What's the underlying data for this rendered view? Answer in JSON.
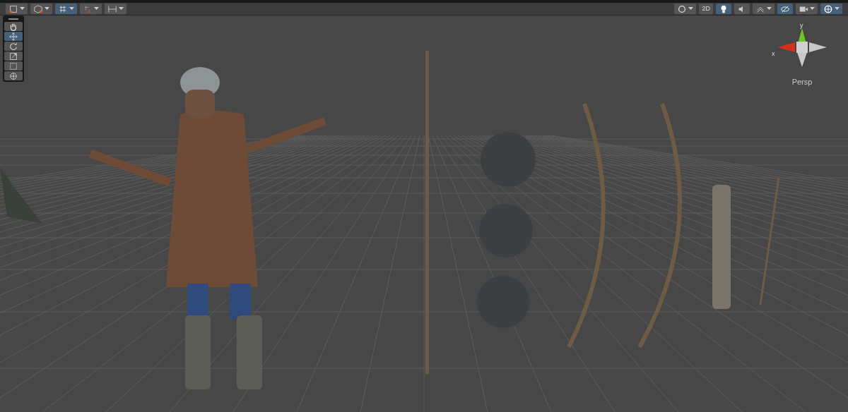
{
  "toolbar_left": [
    {
      "kind": "rect-tool",
      "selected": false,
      "dropdown": true
    },
    {
      "kind": "cube",
      "selected": false,
      "dropdown": true
    },
    {
      "kind": "grid-snap",
      "selected": true,
      "dropdown": true
    },
    {
      "kind": "increment-snap",
      "selected": false,
      "dropdown": true
    },
    {
      "kind": "ruler",
      "selected": false,
      "dropdown": true
    }
  ],
  "toolbar_right": [
    {
      "kind": "shading",
      "selected": false,
      "dropdown": true
    },
    {
      "kind": "text",
      "label": "2D",
      "selected": false,
      "dropdown": false
    },
    {
      "kind": "light",
      "selected": true,
      "dropdown": false
    },
    {
      "kind": "audio",
      "selected": false,
      "dropdown": false
    },
    {
      "kind": "effects",
      "selected": false,
      "dropdown": true
    },
    {
      "kind": "hidden",
      "selected": true,
      "dropdown": false
    },
    {
      "kind": "camera",
      "selected": false,
      "dropdown": true
    },
    {
      "kind": "gizmos",
      "selected": true,
      "dropdown": true
    }
  ],
  "tools": [
    {
      "kind": "hand",
      "selected": false
    },
    {
      "kind": "move",
      "selected": true
    },
    {
      "kind": "rotate",
      "selected": false
    },
    {
      "kind": "scale",
      "selected": false
    },
    {
      "kind": "rect",
      "selected": false
    },
    {
      "kind": "transform",
      "selected": false
    }
  ],
  "gizmo": {
    "y_label": "y",
    "x_label": "x",
    "projection": "Persp"
  }
}
